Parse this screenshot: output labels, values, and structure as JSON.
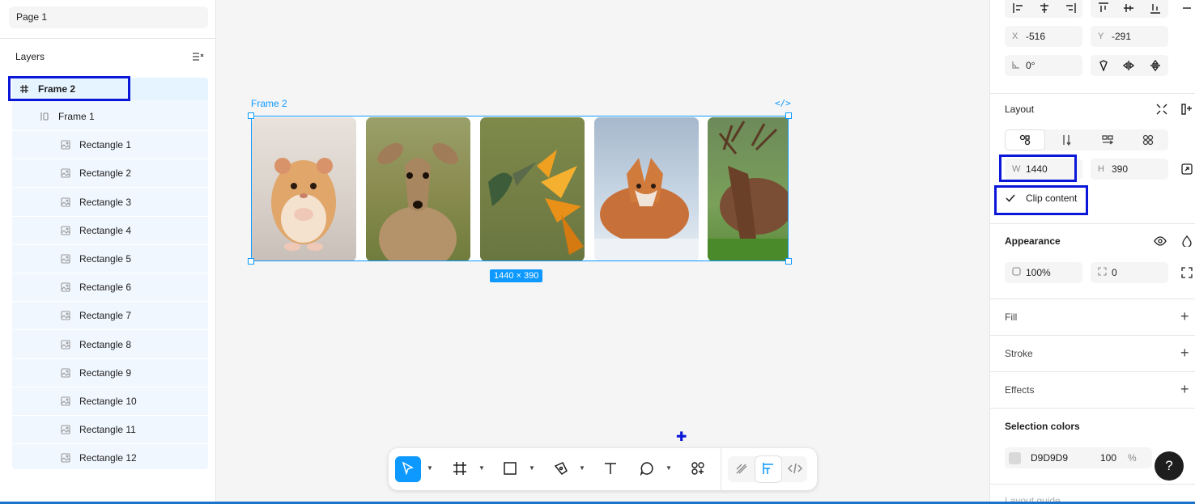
{
  "left_panel": {
    "page_name": "Page 1",
    "layers_title": "Layers",
    "layers": [
      {
        "label": "Frame 2",
        "icon": "frame-icon",
        "indent": 0,
        "selected": true
      },
      {
        "label": "Frame 1",
        "icon": "auto-layout-icon",
        "indent": 1
      },
      {
        "label": "Rectangle 1",
        "icon": "image-icon",
        "indent": 2
      },
      {
        "label": "Rectangle 2",
        "icon": "image-icon",
        "indent": 2
      },
      {
        "label": "Rectangle 3",
        "icon": "image-icon",
        "indent": 2
      },
      {
        "label": "Rectangle 4",
        "icon": "image-icon",
        "indent": 2
      },
      {
        "label": "Rectangle 5",
        "icon": "image-icon",
        "indent": 2
      },
      {
        "label": "Rectangle 6",
        "icon": "image-icon",
        "indent": 2
      },
      {
        "label": "Rectangle 7",
        "icon": "image-icon",
        "indent": 2
      },
      {
        "label": "Rectangle 8",
        "icon": "image-icon",
        "indent": 2
      },
      {
        "label": "Rectangle 9",
        "icon": "image-icon",
        "indent": 2
      },
      {
        "label": "Rectangle 10",
        "icon": "image-icon",
        "indent": 2
      },
      {
        "label": "Rectangle 11",
        "icon": "image-icon",
        "indent": 2
      },
      {
        "label": "Rectangle 12",
        "icon": "image-icon",
        "indent": 2
      }
    ]
  },
  "canvas": {
    "frame_label": "Frame 2",
    "code_mark": "</>",
    "size_badge": "1440 × 390",
    "photos": [
      "hamster",
      "deer",
      "hummingbird",
      "fox",
      "stag"
    ]
  },
  "right_panel": {
    "x_label": "X",
    "x_value": "-516",
    "y_label": "Y",
    "y_value": "-291",
    "rotation_value": "0°",
    "layout_title": "Layout",
    "w_label": "W",
    "w_value": "1440",
    "h_label": "H",
    "h_value": "390",
    "clip_content_label": "Clip content",
    "clip_content_checked": true,
    "appearance_title": "Appearance",
    "opacity_value": "100%",
    "radius_value": "0",
    "fill_title": "Fill",
    "stroke_title": "Stroke",
    "effects_title": "Effects",
    "selection_colors_title": "Selection colors",
    "selection_color_hex": "D9D9D9",
    "selection_color_opacity": "100",
    "percent_sign": "%",
    "layout_guide_title": "Layout guide",
    "help_label": "?"
  },
  "colors": {
    "accent": "#0d99ff",
    "highlight": "#0a16d8",
    "swatch": "#d9d9d9"
  }
}
